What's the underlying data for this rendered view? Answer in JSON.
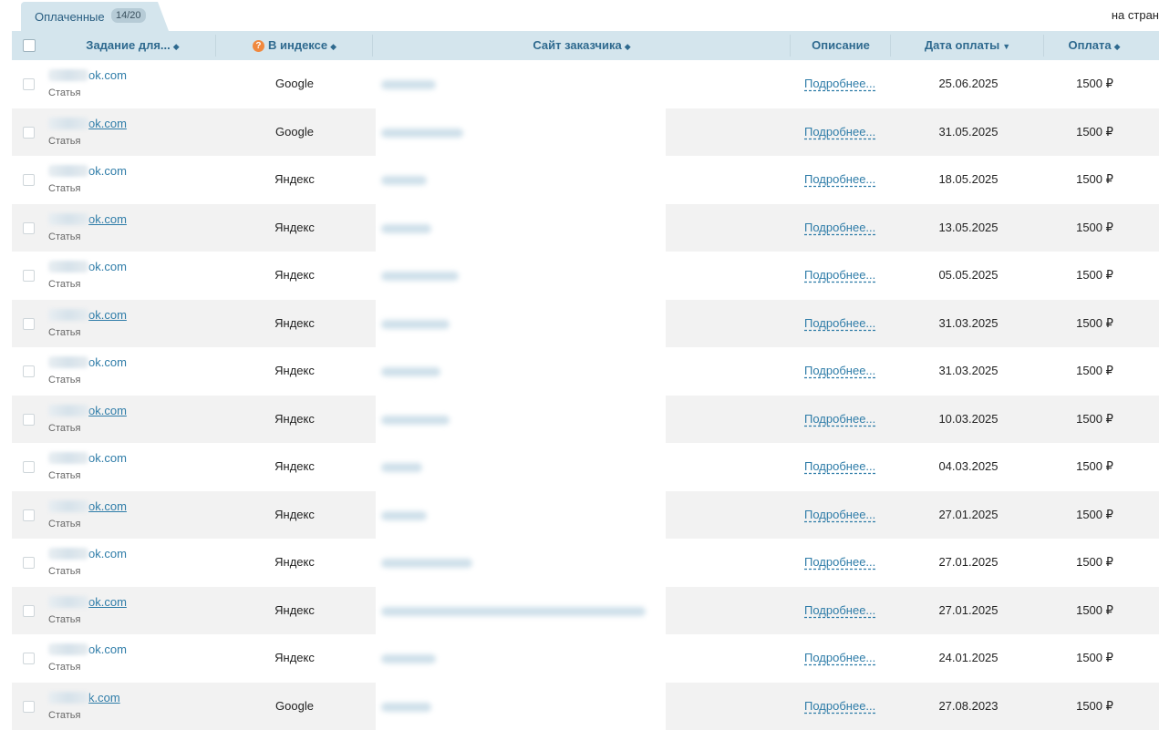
{
  "tab": {
    "label": "Оплаченные",
    "count": "14/20"
  },
  "per_page_label": "на стран",
  "columns": {
    "task": "Задание для...",
    "index": "В индексе",
    "customer": "Сайт заказчика",
    "description": "Описание",
    "date": "Дата оплаты",
    "payment": "Оплата"
  },
  "rows": [
    {
      "site": "ok.com",
      "kind": "Статья",
      "engine": "Google",
      "desc": "Подробнее...",
      "date": "25.06.2025",
      "pay": "1500 ₽"
    },
    {
      "site": "ok.com",
      "kind": "Статья",
      "engine": "Google",
      "desc": "Подробнее...",
      "date": "31.05.2025",
      "pay": "1500 ₽"
    },
    {
      "site": "ok.com",
      "kind": "Статья",
      "engine": "Яндекс",
      "desc": "Подробнее...",
      "date": "18.05.2025",
      "pay": "1500 ₽"
    },
    {
      "site": "ok.com",
      "kind": "Статья",
      "engine": "Яндекс",
      "desc": "Подробнее...",
      "date": "13.05.2025",
      "pay": "1500 ₽"
    },
    {
      "site": "ok.com",
      "kind": "Статья",
      "engine": "Яндекс",
      "desc": "Подробнее...",
      "date": "05.05.2025",
      "pay": "1500 ₽"
    },
    {
      "site": "ok.com",
      "kind": "Статья",
      "engine": "Яндекс",
      "desc": "Подробнее...",
      "date": "31.03.2025",
      "pay": "1500 ₽"
    },
    {
      "site": "ok.com",
      "kind": "Статья",
      "engine": "Яндекс",
      "desc": "Подробнее...",
      "date": "31.03.2025",
      "pay": "1500 ₽"
    },
    {
      "site": "ok.com",
      "kind": "Статья",
      "engine": "Яндекс",
      "desc": "Подробнее...",
      "date": "10.03.2025",
      "pay": "1500 ₽"
    },
    {
      "site": "ok.com",
      "kind": "Статья",
      "engine": "Яндекс",
      "desc": "Подробнее...",
      "date": "04.03.2025",
      "pay": "1500 ₽"
    },
    {
      "site": "ok.com",
      "kind": "Статья",
      "engine": "Яндекс",
      "desc": "Подробнее...",
      "date": "27.01.2025",
      "pay": "1500 ₽"
    },
    {
      "site": "ok.com",
      "kind": "Статья",
      "engine": "Яндекс",
      "desc": "Подробнее...",
      "date": "27.01.2025",
      "pay": "1500 ₽"
    },
    {
      "site": "ok.com",
      "kind": "Статья",
      "engine": "Яндекс",
      "desc": "Подробнее...",
      "date": "27.01.2025",
      "pay": "1500 ₽"
    },
    {
      "site": "ok.com",
      "kind": "Статья",
      "engine": "Яндекс",
      "desc": "Подробнее...",
      "date": "24.01.2025",
      "pay": "1500 ₽"
    },
    {
      "site": "k.com",
      "kind": "Статья",
      "engine": "Google",
      "desc": "Подробнее...",
      "date": "27.08.2023",
      "pay": "1500 ₽"
    }
  ]
}
